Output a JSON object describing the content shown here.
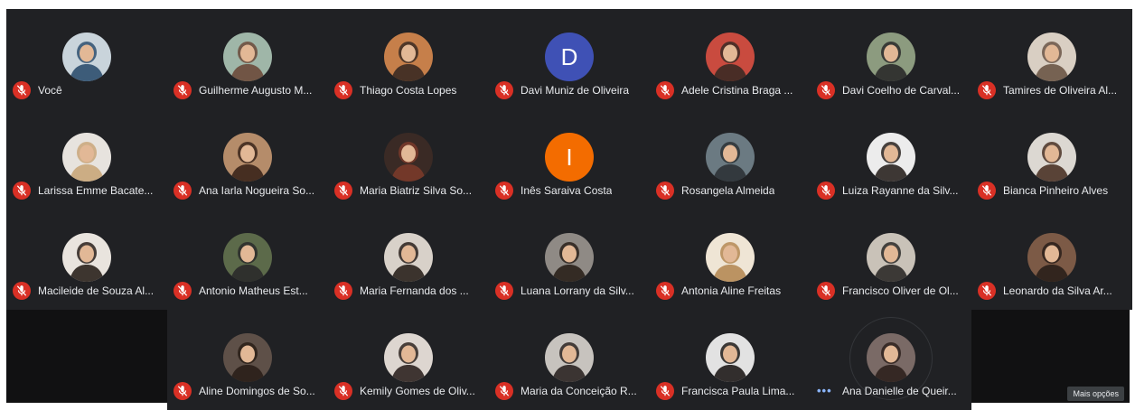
{
  "meeting": {
    "more_options_label": "Mais opções",
    "participants": [
      {
        "name": "Você",
        "avatar": "photo",
        "bg": "#c9d4db",
        "fg": "#2e4f6e"
      },
      {
        "name": "Guilherme Augusto M...",
        "avatar": "photo",
        "bg": "#9fb6a8",
        "fg": "#6b4a3a"
      },
      {
        "name": "Thiago Costa Lopes",
        "avatar": "photo",
        "bg": "#c67f4a",
        "fg": "#3a2a22"
      },
      {
        "name": "Davi Muniz de Oliveira",
        "avatar": "letter",
        "letter": "D",
        "bg": "#3f51b5"
      },
      {
        "name": "Adele Cristina Braga ...",
        "avatar": "photo",
        "bg": "#c94b3f",
        "fg": "#3b2a24"
      },
      {
        "name": "Davi Coelho de Carval...",
        "avatar": "photo",
        "bg": "#8c9b7f",
        "fg": "#2a2a2a"
      },
      {
        "name": "Tamires de Oliveira Al...",
        "avatar": "photo",
        "bg": "#d9cfc3",
        "fg": "#6a5546"
      },
      {
        "name": "Larissa Emme Bacate...",
        "avatar": "photo",
        "bg": "#e7e3de",
        "fg": "#c9a67a"
      },
      {
        "name": "Ana Iarla Nogueira So...",
        "avatar": "photo",
        "bg": "#b58c6a",
        "fg": "#3a241a"
      },
      {
        "name": "Maria Biatriz Silva So...",
        "avatar": "photo",
        "bg": "#3a2a25",
        "fg": "#7a3a2a"
      },
      {
        "name": "Inês Saraiva Costa",
        "avatar": "letter",
        "letter": "I",
        "bg": "#f36c00"
      },
      {
        "name": "Rosangela Almeida",
        "avatar": "photo",
        "bg": "#6b7a82",
        "fg": "#2d3236"
      },
      {
        "name": "Luiza Rayanne da Silv...",
        "avatar": "photo",
        "bg": "#ececec",
        "fg": "#2a2320"
      },
      {
        "name": "Bianca Pinheiro Alves",
        "avatar": "photo",
        "bg": "#dcd8d2",
        "fg": "#4a3326"
      },
      {
        "name": "Macileide de Souza Al...",
        "avatar": "photo",
        "bg": "#e9e4de",
        "fg": "#2a211c"
      },
      {
        "name": "Antonio Matheus Est...",
        "avatar": "photo",
        "bg": "#5c6a4a",
        "fg": "#2a2a2a"
      },
      {
        "name": "Maria Fernanda dos ...",
        "avatar": "photo",
        "bg": "#d8d1c9",
        "fg": "#2a211c"
      },
      {
        "name": "Luana Lorrany da Silv...",
        "avatar": "photo",
        "bg": "#8f8a85",
        "fg": "#2a201a"
      },
      {
        "name": "Antonia Aline Freitas",
        "avatar": "photo",
        "bg": "#efe5d5",
        "fg": "#b58a55"
      },
      {
        "name": "Francisco Oliver de Ol...",
        "avatar": "photo",
        "bg": "#c9c2b8",
        "fg": "#2c2a28"
      },
      {
        "name": "Leonardo da Silva Ar...",
        "avatar": "photo",
        "bg": "#7c5a46",
        "fg": "#2a1f1a"
      },
      {
        "name": "Aline Domingos de So...",
        "avatar": "photo",
        "bg": "#5e5048",
        "fg": "#2a1e18"
      },
      {
        "name": "Kemily Gomes de Oliv...",
        "avatar": "photo",
        "bg": "#ddd6d0",
        "fg": "#2e2420"
      },
      {
        "name": "Maria da Conceição R...",
        "avatar": "photo",
        "bg": "#c7c3be",
        "fg": "#2b2522"
      },
      {
        "name": "Francisca Paula Lima...",
        "avatar": "photo",
        "bg": "#e2e2e2",
        "fg": "#1f1b19"
      },
      {
        "name": "Ana Danielle de Queir...",
        "avatar": "photo",
        "bg": "#7a6a66",
        "fg": "#2e211d",
        "speaking": true
      }
    ]
  },
  "colors": {
    "tile_bg": "#202124",
    "stage_bg": "#111112",
    "muted_mic": "#d93025",
    "speaking_dots": "#8ab4f8"
  }
}
